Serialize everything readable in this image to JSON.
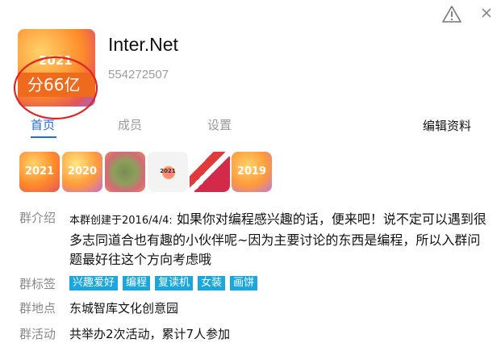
{
  "avatar": {
    "year": "2021",
    "band_text": "分66亿"
  },
  "group": {
    "name": "Inter.Net",
    "id": "554272507"
  },
  "tabs": [
    {
      "label": "首页",
      "active": true
    },
    {
      "label": "成员",
      "active": false
    },
    {
      "label": "设置",
      "active": false
    }
  ],
  "edit_label": "编辑资料",
  "thumbnails": [
    "2021",
    "2020",
    "",
    "2021",
    "",
    "2019"
  ],
  "intro": {
    "label": "群介绍",
    "prefix": "本群创建于2016/4/4:",
    "text": "如果你对编程感兴趣的话，便来吧！说不定可以遇到很多志同道合也有趣的小伙伴呢~因为主要讨论的东西是编程，所以入群问题最好往这个方向考虑哦"
  },
  "tags": {
    "label": "群标签",
    "items": [
      "兴趣爱好",
      "编程",
      "复读机",
      "女装",
      "画饼"
    ]
  },
  "location": {
    "label": "群地点",
    "value": "东城智库文化创意园"
  },
  "activity": {
    "label": "群活动",
    "value": "共举办2次活动，累计7人参加"
  },
  "colors": {
    "accent": "#1e6fe0",
    "tag_bg": "#1aa7e0",
    "annotation": "#e02424"
  },
  "icons": [
    "warning-icon",
    "close-icon"
  ]
}
